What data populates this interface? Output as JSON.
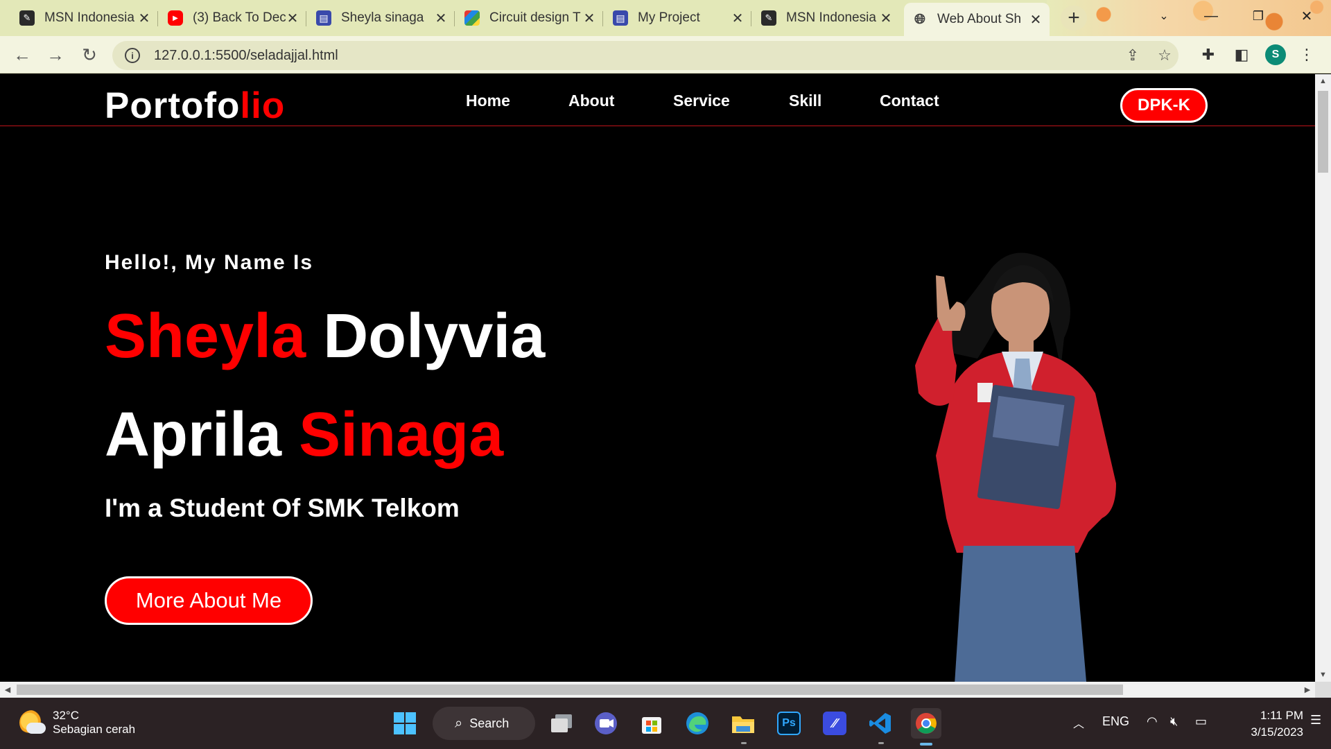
{
  "browser": {
    "tabs": [
      {
        "title": "MSN Indonesia",
        "favicon": "msn-icon"
      },
      {
        "title": "(3) Back To Dec",
        "favicon": "youtube-icon"
      },
      {
        "title": "Sheyla sinaga",
        "favicon": "form-icon"
      },
      {
        "title": "Circuit design T",
        "favicon": "tinkercad-icon"
      },
      {
        "title": "My Project",
        "favicon": "form-icon"
      },
      {
        "title": "MSN Indonesia",
        "favicon": "msn-icon"
      },
      {
        "title": "Web About Sh",
        "favicon": "globe-icon",
        "active": true
      }
    ],
    "close_glyph": "✕",
    "new_tab_glyph": "+",
    "url": "127.0.0.1:5500/seladajjal.html",
    "profile_initial": "S"
  },
  "site": {
    "logo_main": "Portofo",
    "logo_accent": "lio",
    "nav": [
      "Home",
      "About",
      "Service",
      "Skill",
      "Contact"
    ],
    "badge": "DPK-K",
    "greeting": "Hello!, My Name Is",
    "name_line1_red": "Sheyla",
    "name_line1_white": "Dolyvia",
    "name_line2_white": "Aprila",
    "name_line2_red": "Sinaga",
    "role": "I'm a Student Of SMK Telkom",
    "cta": "More About Me",
    "colors": {
      "accent": "#ff0000",
      "background": "#000000",
      "text": "#ffffff"
    }
  },
  "taskbar": {
    "temperature": "32°C",
    "weather_desc": "Sebagian cerah",
    "search_label": "Search",
    "language": "ENG",
    "time": "1:11 PM",
    "date": "3/15/2023",
    "apps": [
      "windows-start-icon",
      "task-view-icon",
      "teams-icon",
      "store-icon",
      "edge-icon",
      "file-explorer-icon",
      "photoshop-icon",
      "app-icon",
      "vscode-icon",
      "chrome-icon"
    ]
  }
}
